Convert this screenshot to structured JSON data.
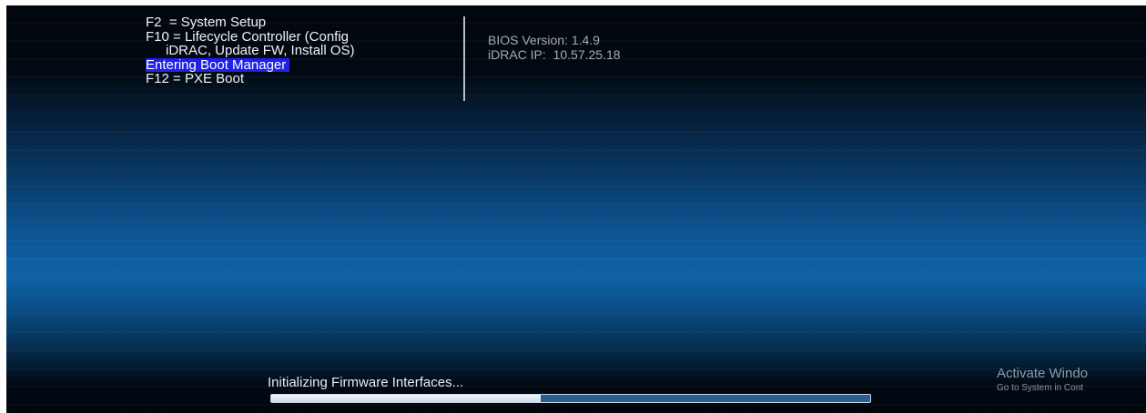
{
  "hotkeys": {
    "f2": "F2  = System Setup",
    "f10": "F10 = Lifecycle Controller (Config",
    "f10_cont": "iDRAC, Update FW, Install OS)",
    "entering": "Entering Boot Manager",
    "f12": "F12 = PXE Boot"
  },
  "sysinfo": {
    "bios_version": "BIOS Version: 1.4.9",
    "idrac_ip": "iDRAC IP:  10.57.25.18"
  },
  "status": {
    "text": "Initializing Firmware Interfaces...",
    "progress_fraction": 0.45
  },
  "watermark": {
    "title": "Activate Windo",
    "subtitle": "Go to System in Cont"
  },
  "colors": {
    "highlight": "#1f20e8",
    "background_top": "#02060d",
    "background_mid": "#0f63a8"
  }
}
